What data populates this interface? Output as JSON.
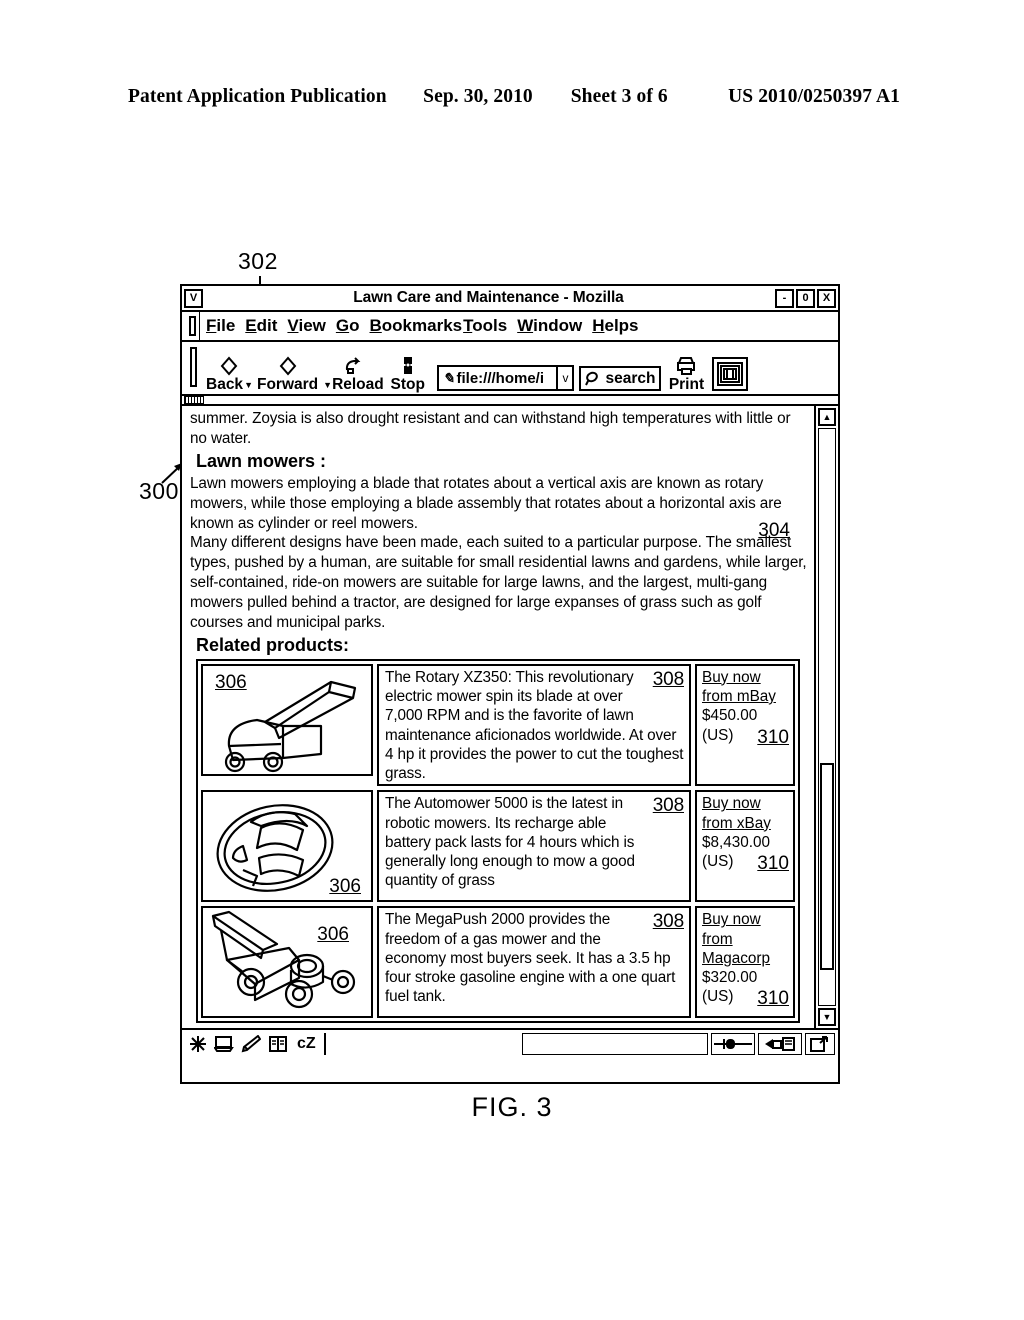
{
  "patent_header": {
    "publication": "Patent Application Publication",
    "date": "Sep. 30, 2010",
    "sheet": "Sheet 3 of 6",
    "number": "US 2010/0250397 A1"
  },
  "figure": {
    "caption": "FIG. 3",
    "callouts": {
      "window": "302",
      "page": "300",
      "content": "304"
    }
  },
  "window": {
    "title": "Lawn Care and Maintenance - Mozilla",
    "system_menu_glyph": "V",
    "controls": {
      "minimize": "-",
      "maximize": "0",
      "close": "X"
    }
  },
  "menubar": {
    "items": [
      {
        "label": "File",
        "accel": "F"
      },
      {
        "label": "Edit",
        "accel": "E"
      },
      {
        "label": "View",
        "accel": "V"
      },
      {
        "label": "Go",
        "accel": "G"
      },
      {
        "label": "Bookmarks",
        "accel": "B"
      },
      {
        "label": "Tools",
        "accel": "T"
      },
      {
        "label": "Window",
        "accel": "W"
      },
      {
        "label": "Helps",
        "accel": "H"
      }
    ]
  },
  "toolbar": {
    "back": "Back",
    "forward": "Forward",
    "reload": "Reload",
    "stop": "Stop",
    "print": "Print",
    "url_value": "file:///home/i",
    "url_dropdown_glyph": "v",
    "search_label": "search"
  },
  "content": {
    "paragraph_1": "summer. Zoysia is also drought resistant and can withstand high temperatures with little or no water.",
    "heading": "Lawn mowers :",
    "paragraph_2": "Lawn mowers employing a blade that rotates about a vertical axis are known as rotary mowers, while those employing a blade assembly that rotates about a horizontal axis are known as cylinder or reel mowers.",
    "paragraph_3": "Many different designs have been made, each suited to a particular purpose. The smallest types, pushed by a human, are suitable for small residential lawns and gardens, while larger, self-contained, ride-on mowers are suitable for large lawns, and the largest, multi-gang mowers pulled behind a tractor, are designed for large expanses of grass such as golf courses and municipal parks.",
    "related_heading": "Related products:"
  },
  "products": [
    {
      "image_ref": "306",
      "image_name": "rotary-mower-illustration",
      "description": "The Rotary XZ350: This revolutionary electric mower spin its blade at over 7,000 RPM and is the favorite of lawn maintenance aficionados worldwide. At over 4 hp it provides the power to cut the toughest grass.",
      "description_ref": "308",
      "buy_link": "Buy now from mBay",
      "price": "$450.00",
      "currency": "(US)",
      "buy_ref": "310"
    },
    {
      "image_ref": "306",
      "image_name": "robotic-mower-illustration",
      "description": "The Automower 5000 is the latest in robotic mowers. Its recharge able battery pack lasts for 4 hours which is generally long enough to mow a good quantity of grass",
      "description_ref": "308",
      "buy_link": "Buy now from xBay",
      "price": "$8,430.00",
      "currency": "(US)",
      "buy_ref": "310"
    },
    {
      "image_ref": "306",
      "image_name": "push-mower-illustration",
      "description": "The MegaPush 2000 provides the freedom of a gas mower and the economy most buyers seek. It has a 3.5 hp four stroke gasoline engine with a one quart fuel tank.",
      "description_ref": "308",
      "buy_link": "Buy now from Magacorp",
      "price": "$320.00",
      "currency": "(US)",
      "buy_ref": "310"
    }
  ],
  "statusbar": {
    "text": "cZ",
    "icons": [
      "asterisk-icon",
      "monitor-icon",
      "pencil-icon",
      "book-icon"
    ]
  },
  "scrollbar": {
    "up_glyph": "▲",
    "down_glyph": "▼"
  }
}
